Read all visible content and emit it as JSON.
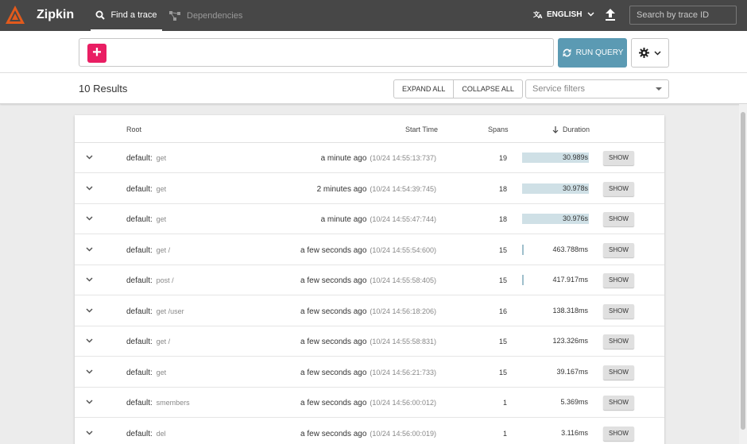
{
  "app": {
    "brand": "Zipkin",
    "brand_color": "#e25a1c",
    "nav": [
      {
        "label": "Find a trace",
        "icon": "search-icon",
        "active": true
      },
      {
        "label": "Dependencies",
        "icon": "dependencies-icon",
        "active": false
      }
    ],
    "language": "ENGLISH",
    "trace_search_placeholder": "Search by trace ID"
  },
  "query": {
    "run_label": "RUN QUERY",
    "run_color": "#5b9ab3",
    "add_color": "#e91e63"
  },
  "results": {
    "count_label": "10 Results",
    "expand_all": "EXPAND ALL",
    "collapse_all": "COLLAPSE ALL",
    "service_filter_placeholder": "Service filters"
  },
  "table": {
    "headers": {
      "root": "Root",
      "start_time": "Start Time",
      "spans": "Spans",
      "duration": "Duration"
    },
    "show_label": "SHOW",
    "rows": [
      {
        "service": "default:",
        "span": "get",
        "relative": "a minute ago",
        "absolute": "(10/24 14:55:13:737)",
        "spans": "19",
        "duration": "30.989s",
        "fraction": 1.0
      },
      {
        "service": "default:",
        "span": "get",
        "relative": "2 minutes ago",
        "absolute": "(10/24 14:54:39:745)",
        "spans": "18",
        "duration": "30.978s",
        "fraction": 0.9996
      },
      {
        "service": "default:",
        "span": "get",
        "relative": "a minute ago",
        "absolute": "(10/24 14:55:47:744)",
        "spans": "18",
        "duration": "30.976s",
        "fraction": 0.9995
      },
      {
        "service": "default:",
        "span": "get /",
        "relative": "a few seconds ago",
        "absolute": "(10/24 14:55:54:600)",
        "spans": "15",
        "duration": "463.788ms",
        "fraction": 0.015
      },
      {
        "service": "default:",
        "span": "post /",
        "relative": "a few seconds ago",
        "absolute": "(10/24 14:55:58:405)",
        "spans": "15",
        "duration": "417.917ms",
        "fraction": 0.0135
      },
      {
        "service": "default:",
        "span": "get /user",
        "relative": "a few seconds ago",
        "absolute": "(10/24 14:56:18:206)",
        "spans": "16",
        "duration": "138.318ms",
        "fraction": 0.0045
      },
      {
        "service": "default:",
        "span": "get /",
        "relative": "a few seconds ago",
        "absolute": "(10/24 14:55:58:831)",
        "spans": "15",
        "duration": "123.326ms",
        "fraction": 0.004
      },
      {
        "service": "default:",
        "span": "get",
        "relative": "a few seconds ago",
        "absolute": "(10/24 14:56:21:733)",
        "spans": "15",
        "duration": "39.167ms",
        "fraction": 0.0013
      },
      {
        "service": "default:",
        "span": "smembers",
        "relative": "a few seconds ago",
        "absolute": "(10/24 14:56:00:012)",
        "spans": "1",
        "duration": "5.369ms",
        "fraction": 0.0002
      },
      {
        "service": "default:",
        "span": "del",
        "relative": "a few seconds ago",
        "absolute": "(10/24 14:56:00:019)",
        "spans": "1",
        "duration": "3.116ms",
        "fraction": 0.0001
      }
    ]
  }
}
